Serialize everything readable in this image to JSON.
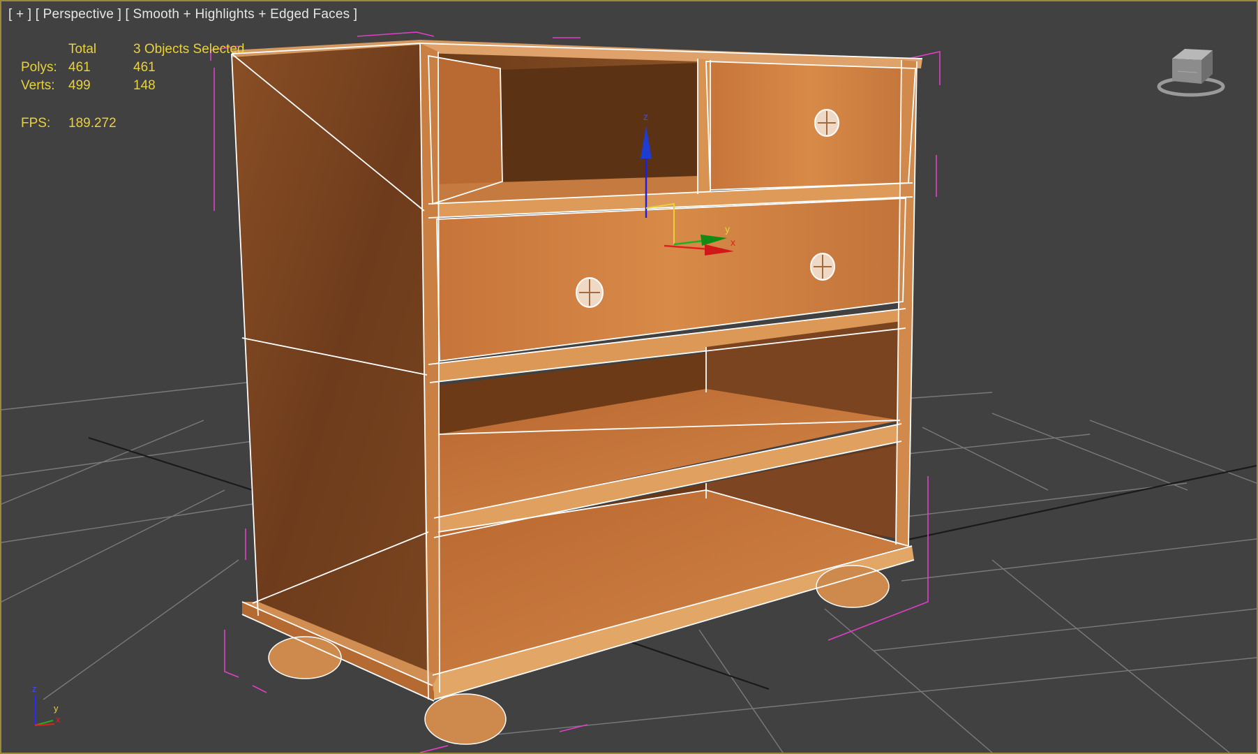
{
  "viewport": {
    "label": "[ + ] [ Perspective ] [ Smooth + Highlights + Edged Faces ]",
    "colors": {
      "background": "#414141",
      "border": "#9a8a3a",
      "grid": "#777777",
      "wood": "#c87a3c",
      "selection_bracket": "#e040c8",
      "stats_text": "#e8d23c"
    }
  },
  "stats": {
    "col_total": "Total",
    "col_selected": "3 Objects Selected",
    "polys_label": "Polys:",
    "polys_total": "461",
    "polys_selected": "461",
    "verts_label": "Verts:",
    "verts_total": "499",
    "verts_selected": "148",
    "fps_label": "FPS:",
    "fps_value": "189.272"
  },
  "gizmo": {
    "x": "x",
    "y": "y",
    "z": "z"
  },
  "tripod": {
    "x": "x",
    "y": "y",
    "z": "z"
  },
  "icons": {
    "viewcube": "viewcube-icon",
    "gizmo": "move-gizmo-icon",
    "tripod": "axis-tripod-icon"
  }
}
